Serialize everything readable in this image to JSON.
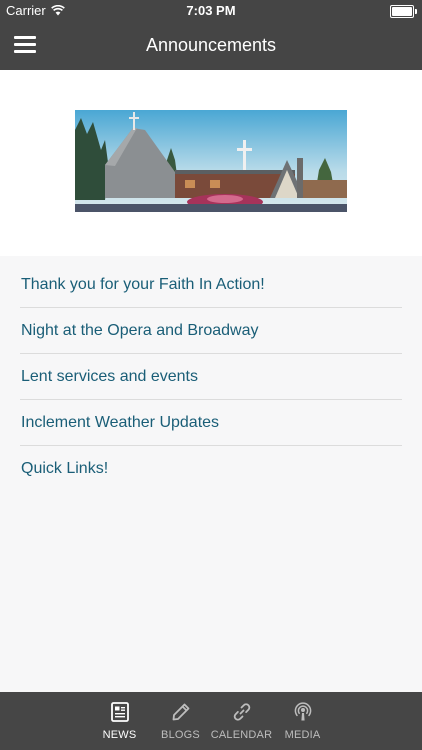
{
  "status_bar": {
    "carrier": "Carrier",
    "time": "7:03 PM",
    "battery_level": 0.9
  },
  "header": {
    "title": "Announcements"
  },
  "announcements": [
    {
      "label": "Thank you for your Faith In Action!"
    },
    {
      "label": "Night at the Opera and Broadway"
    },
    {
      "label": "Lent services and events"
    },
    {
      "label": "Inclement Weather Updates"
    },
    {
      "label": "Quick Links!"
    }
  ],
  "tabs": [
    {
      "label": "NEWS",
      "icon": "newspaper-icon",
      "active": true
    },
    {
      "label": "BLOGS",
      "icon": "pencil-icon",
      "active": false
    },
    {
      "label": "CALENDAR",
      "icon": "link-icon",
      "active": false
    },
    {
      "label": "MEDIA",
      "icon": "podcast-icon",
      "active": false
    }
  ],
  "colors": {
    "bar": "#454545",
    "link_text": "#1a5e77",
    "active_tab": "#ffffff",
    "inactive_tab": "#bdbdbd"
  }
}
